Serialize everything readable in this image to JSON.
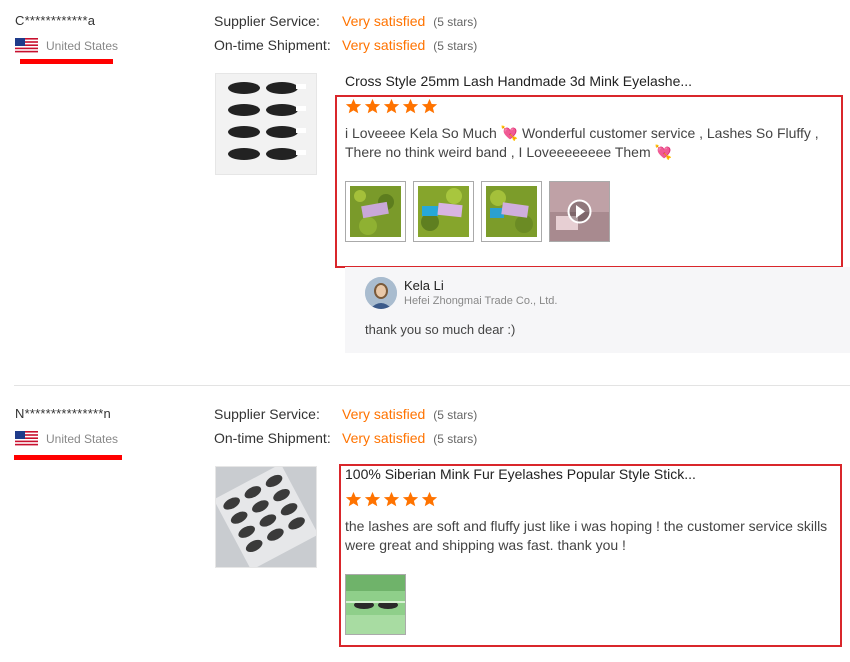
{
  "reviews": [
    {
      "buyer": "C************a",
      "country": "United States",
      "ratings": [
        {
          "label": "Supplier Service:",
          "value": "Very satisfied",
          "stars": "(5 stars)"
        },
        {
          "label": "On-time Shipment:",
          "value": "Very satisfied",
          "stars": "(5 stars)"
        }
      ],
      "product_title": "Cross Style 25mm Lash Handmade 3d Mink Eyelashe...",
      "star_rating": 5,
      "text": "i Loveeee Kela So Much 💘 Wonderful customer service , Lashes So Fluffy , There no think weird band , I Loveeeeeeee Them 💘",
      "images": [
        "review-photo",
        "review-photo",
        "review-photo",
        "review-video"
      ],
      "reply": {
        "name": "Kela Li",
        "company": "Hefei Zhongmai Trade Co., Ltd.",
        "text": "thank you so much dear :)"
      }
    },
    {
      "buyer": "N***************n",
      "country": "United States",
      "ratings": [
        {
          "label": "Supplier Service:",
          "value": "Very satisfied",
          "stars": "(5 stars)"
        },
        {
          "label": "On-time Shipment:",
          "value": "Very satisfied",
          "stars": "(5 stars)"
        }
      ],
      "product_title": "100% Siberian Mink Fur Eyelashes Popular Style Stick...",
      "star_rating": 5,
      "text": "the lashes are soft and fluffy just like i was hoping ! the customer service skills were great and shipping was fast. thank you !",
      "images": [
        "review-photo"
      ]
    }
  ],
  "colors": {
    "accent": "#ff7300",
    "highlight_box": "#d9262b",
    "underline": "#ff0000",
    "reply_bg": "#f6f6f8"
  }
}
